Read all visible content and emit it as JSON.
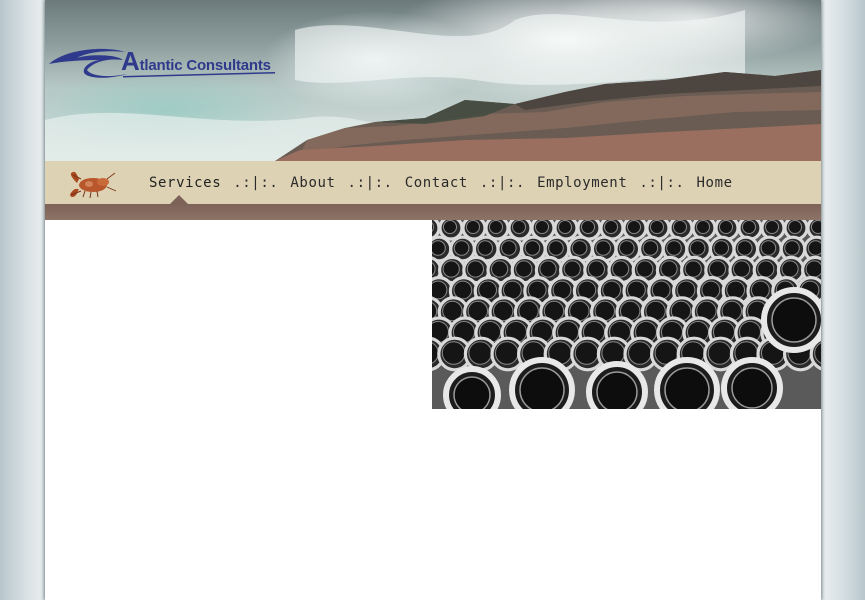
{
  "site": {
    "logo_prefix": "A",
    "logo_rest": "tlantic Consultants"
  },
  "nav": {
    "items": [
      {
        "label": "Services",
        "active": true
      },
      {
        "label": "About",
        "active": false
      },
      {
        "label": "Contact",
        "active": false
      },
      {
        "label": "Employment",
        "active": false
      },
      {
        "label": "Home",
        "active": false
      }
    ],
    "separator": ".:|:."
  },
  "colors": {
    "nav_bg": "#ddd2b4",
    "strip": "#7d6258",
    "logo_blue": "#2f3a8c"
  },
  "icons": {
    "nav_emblem": "lobster-icon"
  }
}
